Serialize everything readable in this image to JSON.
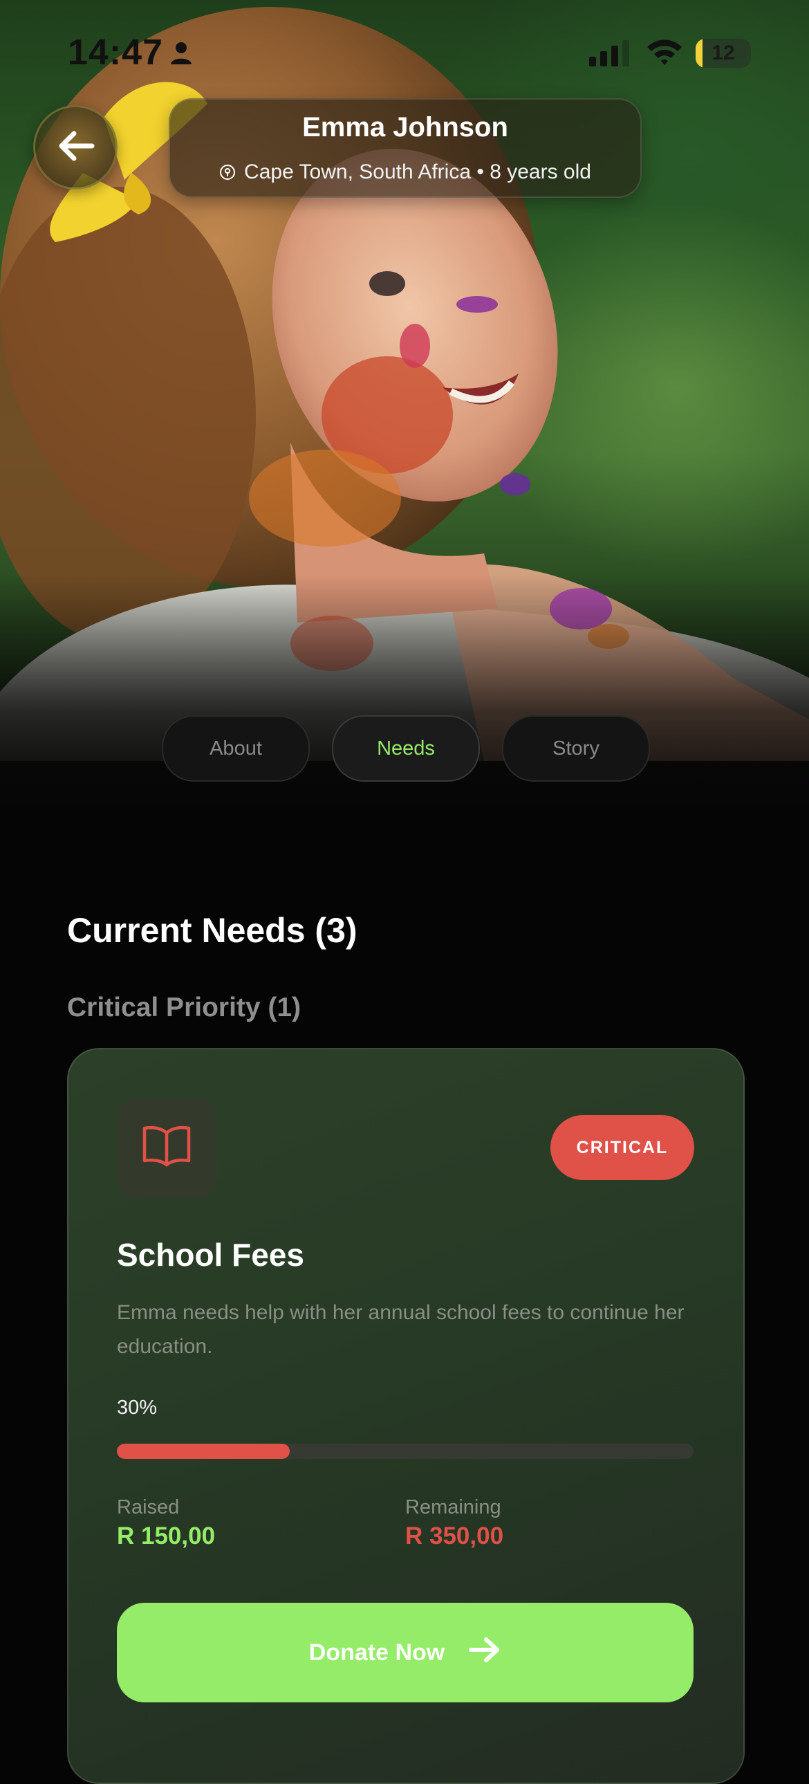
{
  "status_bar": {
    "time": "14:47",
    "battery": "12",
    "icons": [
      "person-icon",
      "signal-icon",
      "wifi-icon",
      "battery-icon"
    ]
  },
  "header": {
    "back_icon": "arrow-left-icon",
    "name": "Emma Johnson",
    "location_icon": "location-icon",
    "meta": "Cape Town, South Africa • 8 years old"
  },
  "tabs": [
    {
      "label": "About",
      "active": false
    },
    {
      "label": "Needs",
      "active": true
    },
    {
      "label": "Story",
      "active": false
    }
  ],
  "needs": {
    "title": "Current Needs (3)",
    "group_title": "Critical Priority (1)",
    "card": {
      "icon": "book-icon",
      "badge": "CRITICAL",
      "title": "School Fees",
      "description": "Emma needs help with her annual school fees to continue her education.",
      "progress_label": "30%",
      "progress": 0.3,
      "raised_label": "Raised",
      "raised_value": "R 150,00",
      "remaining_label": "Remaining",
      "remaining_value": "R 350,00",
      "donate_label": "Donate Now",
      "donate_icon": "arrow-right-icon"
    }
  },
  "colors": {
    "accent_green": "#95ec68",
    "critical_red": "#e05148",
    "card_bg": "#2a3d28",
    "page_bg": "#050505"
  }
}
